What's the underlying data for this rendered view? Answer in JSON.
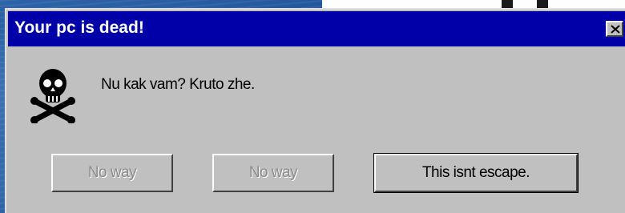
{
  "dialog": {
    "title": "Your pc is dead!",
    "message": "Nu kak vam? Kruto zhe.",
    "icon": "skull-crossbones-icon",
    "close_icon": "close-icon",
    "buttons": [
      {
        "label": "No way",
        "enabled": false
      },
      {
        "label": "No way",
        "enabled": false
      },
      {
        "label": "This isnt escape.",
        "enabled": true
      }
    ]
  },
  "colors": {
    "titlebar": "#0000a8",
    "dialog_face": "#c0c0c0",
    "desktop": "#1f4e8c"
  }
}
